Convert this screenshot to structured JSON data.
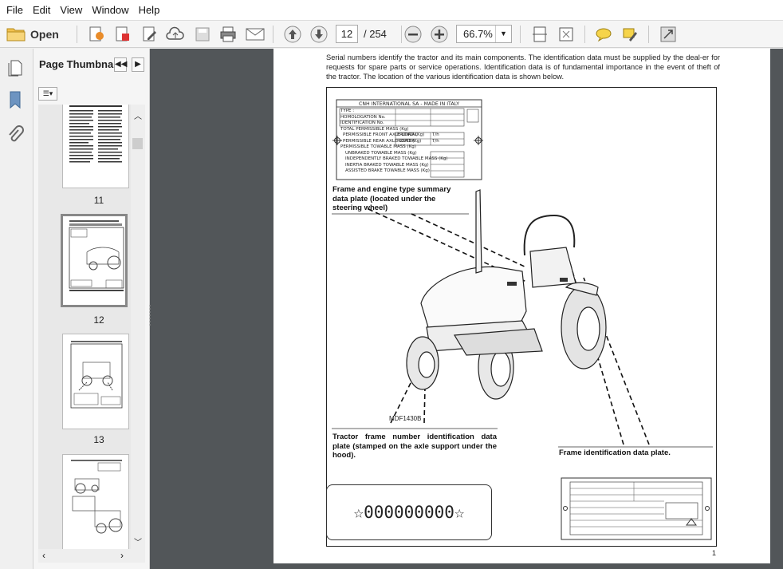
{
  "menu": [
    "File",
    "Edit",
    "View",
    "Window",
    "Help"
  ],
  "toolbar": {
    "open_label": "Open",
    "page_current": "12",
    "page_total": "/ 254",
    "zoom": "66.7%"
  },
  "panel": {
    "title": "Page Thumbna...",
    "thumbs": [
      {
        "label": "11"
      },
      {
        "label": "12"
      },
      {
        "label": "13"
      },
      {
        "label": ""
      }
    ]
  },
  "document": {
    "intro": "Serial numbers identify the tractor and its main components. The identification data must be supplied by the deal-er for requests for spare parts or service operations. Identification data is of fundamental importance in the event of theft of the tractor. The location of the various identification data is shown below.",
    "plate": {
      "header": "CNH INTERNATIONAL SA - MADE IN ITALY",
      "rows": [
        "TYPE :",
        "HOMOLOGATION No.",
        "IDENTIFICATION No.",
        "TOTAL PERMISSIBLE MASS (Kg)",
        "PERMISSIBLE FRONT AXLE LOAD (Kg)",
        "PERMISSIBLE REAR AXLE LOAD (Kg)",
        "PERMISSIBLE TOWABLE MASS (Kg)",
        "UNBRAKED TOWABLE MASS (Kg)",
        "INDEPENDENTLY BRAKED TOWABLE MASS (Kg)",
        "INERTIA BRAKED TOWABLE MASS (Kg)",
        "ASSISTED BRAKE TOWABLE MASS (Kg)"
      ],
      "front_label": "FRONTAL",
      "rear_label": "POSTER",
      "unit": "T/h"
    },
    "callout_engine": "Frame and engine type summary data plate (located under the steering wheel)",
    "callout_frame_number": "Tractor frame number identification data plate (stamped on the axle support under the hood).",
    "callout_frame_plate": "Frame identification data plate.",
    "figure_code": "MDF1430B",
    "serial": "☆000000000☆",
    "page_number": "1"
  }
}
